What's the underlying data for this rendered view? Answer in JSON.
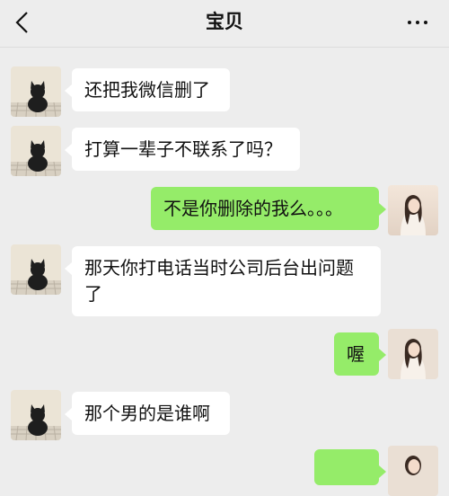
{
  "header": {
    "title": "宝贝",
    "back_icon": "chevron-left-icon",
    "more_icon": "more-dots-icon"
  },
  "colors": {
    "background": "#ededed",
    "incoming_bubble": "#ffffff",
    "outgoing_bubble": "#95ec69"
  },
  "messages": [
    {
      "sender": "them",
      "text": "还把我微信删了"
    },
    {
      "sender": "them",
      "text": "打算一辈子不联系了吗？"
    },
    {
      "sender": "me",
      "text": "不是你删除的我么。。。"
    },
    {
      "sender": "them",
      "text": "那天你打电话当时公司后台出问题了"
    },
    {
      "sender": "me",
      "text": "喔"
    },
    {
      "sender": "them",
      "text": "那个男的是谁啊"
    },
    {
      "sender": "me",
      "text": ""
    }
  ]
}
